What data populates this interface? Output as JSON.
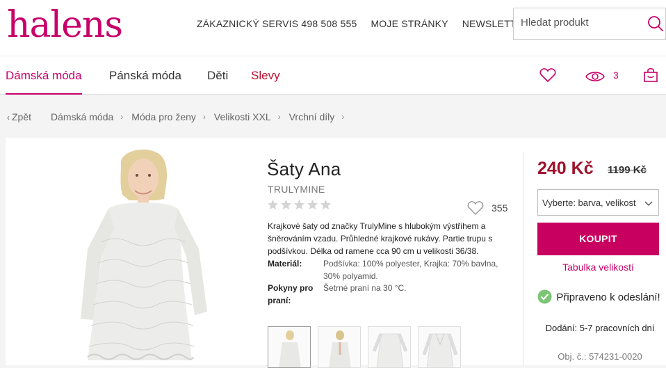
{
  "header": {
    "logo": "halens",
    "links": [
      "ZÁKAZNICKÝ SERVIS 498 508 555",
      "MOJE STRÁNKY",
      "NEWSLETTER"
    ],
    "search_placeholder": "Hledat produkt"
  },
  "nav": {
    "items": [
      {
        "label": "Dámská móda",
        "state": "active"
      },
      {
        "label": "Pánská móda"
      },
      {
        "label": "Děti"
      },
      {
        "label": "Slevy",
        "state": "sale"
      }
    ],
    "icons": [
      "heart-icon",
      "eye-icon",
      "bag-icon"
    ],
    "viewed_count": "3"
  },
  "breadcrumb": {
    "back": "Zpět",
    "items": [
      "Dámská móda",
      "Móda pro ženy",
      "Velikosti XXL",
      "Vrchní díly"
    ]
  },
  "product": {
    "title": "Šaty Ana",
    "brand": "TRULYMINE",
    "rating": 0,
    "rating_max": 5,
    "fav_count": "355",
    "description": "Krajkové šaty od značky TrulyMine s hlubokým výstřihem a šněrováním vzadu. Průhledné krajkové rukávy. Partie trupu s podšívkou. Délka od ramene cca 90 cm u velikosti 36/38.",
    "specs": [
      {
        "label": "Materiál:",
        "value": "Podšívka: 100% polyester, Krajka: 70% bavlna, 30% polyamid."
      },
      {
        "label": "Pokyny pro praní:",
        "value": "Šetrné praní na 30 °C."
      }
    ],
    "thumbnail_count": 4
  },
  "purchase": {
    "price": "240 Kč",
    "old_price": "1199 Kč",
    "variant_placeholder": "Vyberte: barva, velikost",
    "buy_label": "KOUPIT",
    "size_table_label": "Tabulka velikostí",
    "ready_text": "Připraveno k odeslání!",
    "delivery": "Dodání: 5-7 pracovních dní",
    "order_number": "Obj. č.: 574231-0020"
  },
  "colors": {
    "brand": "#c8006a",
    "buy_button": "#c8005f",
    "price": "#a0102a",
    "sale": "#b8102d",
    "ready_check": "#7cc576"
  }
}
